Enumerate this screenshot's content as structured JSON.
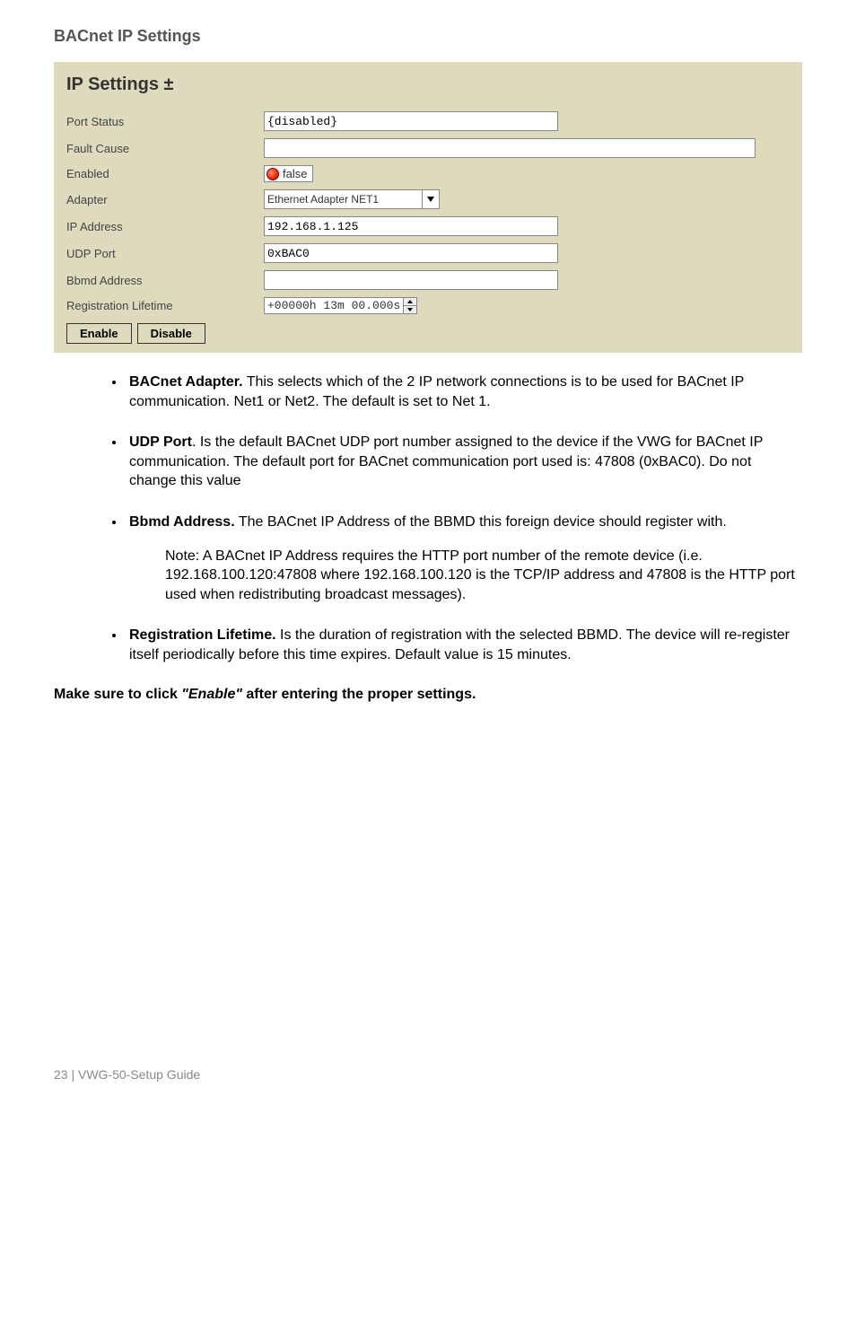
{
  "heading": "BACnet IP Settings",
  "panel": {
    "title": "IP Settings  ±",
    "rows": {
      "port_status": {
        "label": "Port Status",
        "value": "{disabled}"
      },
      "fault_cause": {
        "label": "Fault Cause",
        "value": ""
      },
      "enabled": {
        "label": "Enabled",
        "value": "false"
      },
      "adapter": {
        "label": "Adapter",
        "value": "Ethernet Adapter NET1"
      },
      "ip_address": {
        "label": "IP Address",
        "value": "192.168.1.125"
      },
      "udp_port": {
        "label": "UDP Port",
        "value": "0xBAC0"
      },
      "bbmd_address": {
        "label": "Bbmd Address",
        "value": ""
      },
      "reg_life": {
        "label": "Registration Lifetime",
        "value": "+00000h 13m 00.000s"
      }
    },
    "buttons": {
      "enable": "Enable",
      "disable": "Disable"
    }
  },
  "bullets": {
    "b1_lead": "BACnet Adapter.",
    "b1_rest": " This selects which of the 2 IP network connections is to be used for BACnet IP communication. Net1 or Net2. The default is set to Net 1.",
    "b2_lead": "UDP Port",
    "b2_rest": ". Is the default BACnet UDP port number assigned to the device if the VWG for BACnet IP communication. The default port for BACnet communication port used is: 47808 (0xBAC0). Do not change this value",
    "b3_lead": "Bbmd Address.",
    "b3_rest": " The BACnet IP Address of the BBMD this foreign device should register with.",
    "b3_note": "Note: A BACnet IP Address requires the HTTP port number of the remote device (i.e. 192.168.100.120:47808 where 192.168.100.120 is the TCP/IP address and 47808 is the HTTP port used when redistributing broadcast messages).",
    "b4_lead": "Registration Lifetime.",
    "b4_rest": " Is the duration of registration with the selected BBMD. The device will re-register itself periodically before this time expires. Default value is 15 minutes."
  },
  "final": {
    "pre": "Make sure to click ",
    "em": "\"Enable\"",
    "post": " after entering the proper settings."
  },
  "footer": "23 | VWG-50-Setup Guide"
}
